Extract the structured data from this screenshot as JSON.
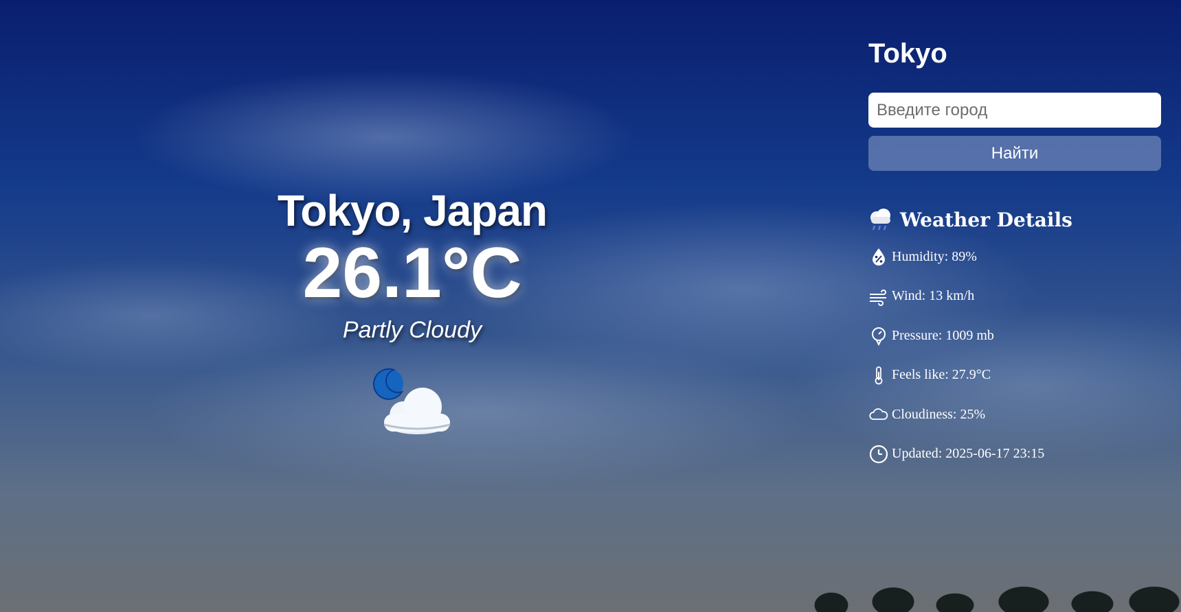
{
  "current": {
    "location": "Tokyo, Japan",
    "temperature": "26.1°C",
    "condition": "Partly Cloudy",
    "icon": "partly-cloudy-night-icon"
  },
  "sidebar": {
    "city": "Tokyo",
    "search": {
      "placeholder": "Введите город",
      "value": ""
    },
    "button_label": "Найти",
    "details_title": "Weather Details",
    "details_icon": "cloud-rain-icon",
    "details": [
      {
        "icon": "humidity-icon",
        "text": "Humidity: 89%"
      },
      {
        "icon": "wind-icon",
        "text": "Wind: 13 km/h"
      },
      {
        "icon": "pressure-gauge-icon",
        "text": "Pressure: 1009 mb"
      },
      {
        "icon": "thermometer-icon",
        "text": "Feels like: 27.9°C"
      },
      {
        "icon": "cloud-icon",
        "text": "Cloudiness: 25%"
      },
      {
        "icon": "clock-icon",
        "text": "Updated: 2025-06-17 23:15"
      }
    ]
  },
  "colors": {
    "sky_top": "#0a1e6e",
    "moon": "#1565c0",
    "button_bg": "#8ca0c8"
  }
}
